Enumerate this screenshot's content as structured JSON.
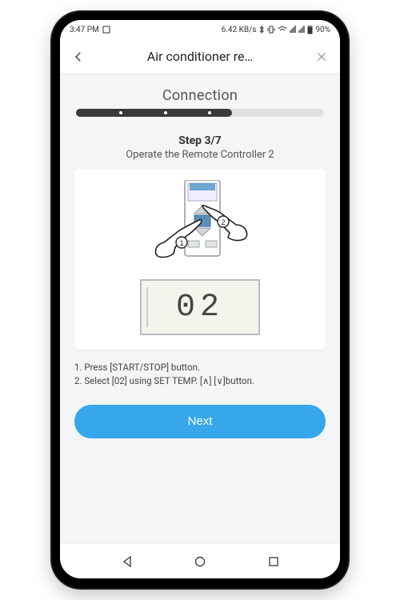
{
  "statusbar": {
    "time": "3:47 PM",
    "net_rate": "6.42 KB/s",
    "battery": "90%"
  },
  "appbar": {
    "title": "Air conditioner re…"
  },
  "section_title": "Connection",
  "progress": {
    "current": 3,
    "total": 7,
    "fill_pct": 63
  },
  "step": {
    "label": "Step 3/7",
    "subtitle": "Operate the Remote Controller 2"
  },
  "lcd_value": "02",
  "instructions": [
    "1. Press [START/STOP] button.",
    "2. Select [02] using SET TEMP. [∧] [∨]button."
  ],
  "next_label": "Next",
  "colors": {
    "accent": "#36a7ea"
  }
}
